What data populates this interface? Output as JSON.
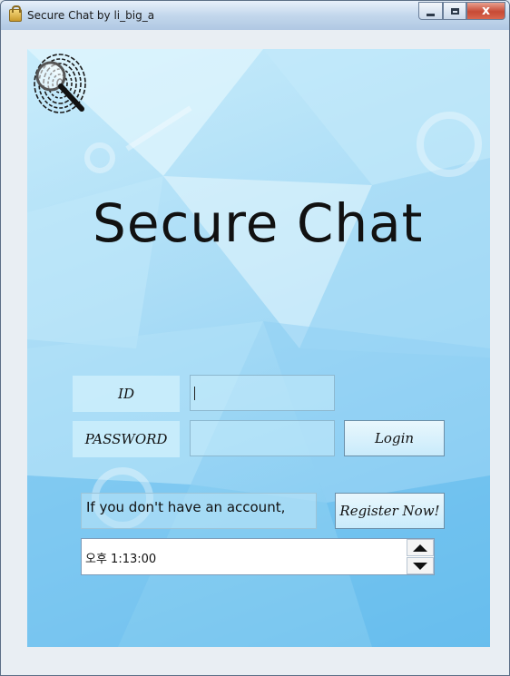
{
  "window": {
    "title": "Secure Chat by li_big_a",
    "icon": "lock-icon",
    "controls": {
      "minimize": "minimize-icon",
      "maximize": "maximize-icon",
      "close_label": "x"
    }
  },
  "logo": {
    "icon": "fingerprint-magnifier-icon"
  },
  "heading": "Secure Chat",
  "login_form": {
    "id_label": "ID",
    "password_label": "PASSWORD",
    "id_value": "",
    "password_value": "",
    "login_button": "Login"
  },
  "register": {
    "notice": "If you don't have an account,",
    "button": "Register Now!"
  },
  "clock": {
    "value": "오후 1:13:00",
    "up_icon": "arrow-up-icon",
    "down_icon": "arrow-down-icon"
  },
  "colors": {
    "accent": "#8fd0f3",
    "title_bar": "#b6cde6",
    "close": "#c74a35"
  }
}
